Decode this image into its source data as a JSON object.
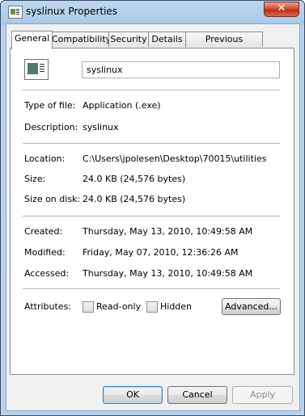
{
  "window": {
    "title": "syslinux Properties",
    "close_glyph": "✕"
  },
  "tabs": [
    {
      "label": "General",
      "active": true
    },
    {
      "label": "Compatibility",
      "active": false
    },
    {
      "label": "Security",
      "active": false
    },
    {
      "label": "Details",
      "active": false
    },
    {
      "label": "Previous Versions",
      "active": false
    }
  ],
  "file": {
    "icon": "application-icon",
    "name": "syslinux",
    "type_label": "Type of file:",
    "type_value": "Application (.exe)",
    "description_label": "Description:",
    "description_value": "syslinux",
    "location_label": "Location:",
    "location_value": "C:\\Users\\jpolesen\\Desktop\\70015\\utilities",
    "size_label": "Size:",
    "size_value": "24.0 KB (24,576 bytes)",
    "size_on_disk_label": "Size on disk:",
    "size_on_disk_value": "24.0 KB (24,576 bytes)",
    "created_label": "Created:",
    "created_value": "Thursday, May 13, 2010, 10:49:58 AM",
    "modified_label": "Modified:",
    "modified_value": "Friday, May 07, 2010, 12:36:26 AM",
    "accessed_label": "Accessed:",
    "accessed_value": "Thursday, May 13, 2010, 10:49:58 AM"
  },
  "attributes": {
    "label": "Attributes:",
    "read_only": {
      "label": "Read-only",
      "checked": false
    },
    "hidden": {
      "label": "Hidden",
      "checked": false
    },
    "advanced_button": "Advanced..."
  },
  "buttons": {
    "ok": "OK",
    "cancel": "Cancel",
    "apply": "Apply"
  }
}
